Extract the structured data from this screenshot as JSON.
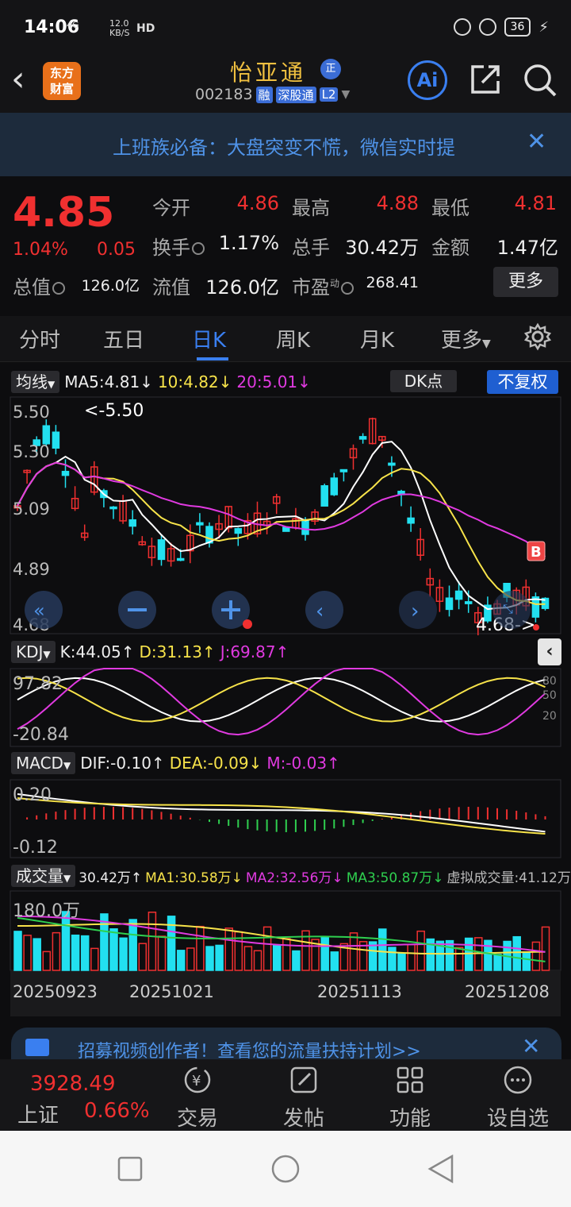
{
  "status_bar": {
    "time": "14:06",
    "network": "4G",
    "speed_value": "12.0",
    "speed_unit": "KB/S",
    "hd": "HD",
    "battery": "36"
  },
  "header": {
    "stock_name": "怡亚通",
    "zheng_badge": "正",
    "stock_code": "002183",
    "tag_rong": "融",
    "tag_sgt": "深股通",
    "tag_l2": "L2",
    "logo_text_1": "东方",
    "logo_text_2": "财富",
    "ai_label": "Ai"
  },
  "banner": {
    "text": "上班族必备：大盘突变不慌，微信实时提",
    "close": "✕"
  },
  "quote": {
    "price": "4.85",
    "change_pct": "1.04%",
    "change_val": "0.05",
    "open_label": "今开",
    "open": "4.86",
    "high_label": "最高",
    "high": "4.88",
    "low_label": "最低",
    "low": "4.81",
    "turnover_label": "换手",
    "turnover": "1.17%",
    "volume_label": "总手",
    "volume": "30.42万",
    "amount_label": "金额",
    "amount": "1.47亿",
    "mktcap_label": "总值",
    "mktcap": "126.0亿",
    "float_label": "流值",
    "float_cap": "126.0亿",
    "pe_label": "市盈",
    "pe_sup": "动",
    "pe": "268.41",
    "more": "更多"
  },
  "tabs": {
    "t1": "分时",
    "t2": "五日",
    "t3": "日K",
    "t4": "周K",
    "t5": "月K",
    "t6": "更多"
  },
  "kline": {
    "ma_dd": "均线",
    "ma5": "MA5:4.81↓",
    "ma10": "10:4.82↓",
    "ma20": "20:5.01↓",
    "dk": "DK点",
    "fq": "不复权",
    "y_labels": [
      "5.50",
      "5.30",
      "5.09",
      "4.89",
      "4.68"
    ],
    "max_label": "<-5.50",
    "min_label": "4.68->",
    "b_marker": "B",
    "colors": {
      "up": "#f03030",
      "down": "#22e0f0",
      "ma5": "#ffffff",
      "ma10": "#f7e34a",
      "ma20": "#e03ae0"
    }
  },
  "kdj": {
    "dd": "KDJ",
    "k": "K:44.05↑",
    "d": "D:31.13↑",
    "j": "J:69.87↑",
    "y_top": "97.82",
    "y_bot": "-20.84",
    "r80": "80",
    "r50": "50",
    "r20": "20"
  },
  "macd": {
    "dd": "MACD",
    "dif": "DIF:-0.10↑",
    "dea": "DEA:-0.09↓",
    "m": "M:-0.03↑",
    "y_top": "0.20",
    "y_bot": "-0.12"
  },
  "vol": {
    "dd": "成交量",
    "v": "30.42万↑",
    "ma1": "MA1:30.58万↓",
    "ma2": "MA2:32.56万↓",
    "ma3": "MA3:50.87万↓",
    "virtual": "虚拟成交量:41.12万",
    "y_top": "180.0万"
  },
  "dates": [
    "20250923",
    "20251021",
    "20251113",
    "20251208"
  ],
  "promo": {
    "text": "招募视频创作者！查看您的流量扶持计划>>",
    "close": "✕"
  },
  "bottom_nav": {
    "index_val": "3928.49",
    "index_name": "上证",
    "index_pct": "0.66%",
    "trade": "交易",
    "post": "发帖",
    "func": "功能",
    "watch": "设自选"
  }
}
